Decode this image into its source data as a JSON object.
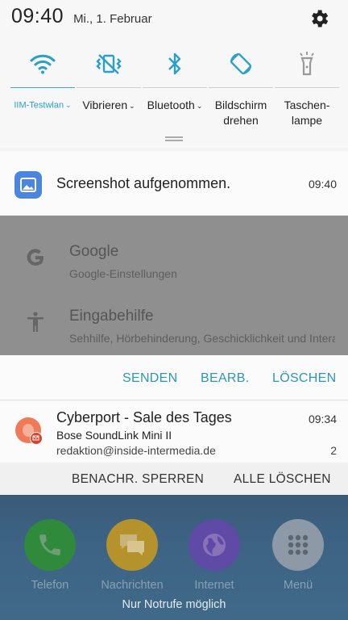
{
  "status": {
    "time": "09:40",
    "date": "Mi., 1. Februar"
  },
  "quick_toggles": [
    {
      "label": "IIM-Testwlan",
      "icon": "wifi-icon",
      "active": true
    },
    {
      "label": "Vibrieren",
      "icon": "vibrate-icon",
      "active": false
    },
    {
      "label": "Bluetooth",
      "icon": "bluetooth-icon",
      "active": false
    },
    {
      "label_line1": "Bildschirm",
      "label_line2": "drehen",
      "icon": "rotate-icon",
      "active": false
    },
    {
      "label_line1": "Taschen-",
      "label_line2": "lampe",
      "icon": "flashlight-icon",
      "active": false
    }
  ],
  "screenshot_notification": {
    "title": "Screenshot aufgenommen.",
    "time": "09:40",
    "preview": [
      {
        "title": "Google",
        "subtitle": "Google-Einstellungen",
        "icon": "google-icon"
      },
      {
        "title": "Eingabehilfe",
        "subtitle": "Sehhilfe, Hörbehinderung, Geschicklichkeit und Interaktion",
        "icon": "accessibility-icon"
      }
    ],
    "actions": {
      "send": "SENDEN",
      "edit": "BEARB.",
      "delete": "LÖSCHEN"
    }
  },
  "mail_notification": {
    "title": "Cyberport - Sale des Tages",
    "time": "09:34",
    "subject": "Bose SoundLink Mini II",
    "account": "redaktion@inside-intermedia.de",
    "count": "2"
  },
  "panel_actions": {
    "block": "BENACHR. SPERREN",
    "clear_all": "ALLE LÖSCHEN"
  },
  "dock": {
    "apps": [
      {
        "label": "Telefon",
        "icon": "phone-icon",
        "color": "#3aa84a"
      },
      {
        "label": "Nachrichten",
        "icon": "messages-icon",
        "color": "#f2b632"
      },
      {
        "label": "Internet",
        "icon": "internet-icon",
        "color": "#7a55d6"
      },
      {
        "label": "Menü",
        "icon": "apps-menu-icon",
        "color": "#eeeeee"
      }
    ],
    "emergency_text": "Nur Notrufe möglich"
  },
  "colors": {
    "accent": "#2997bd",
    "panel_bg": "#f7f7f7",
    "dock_bg": "#3d6385"
  }
}
